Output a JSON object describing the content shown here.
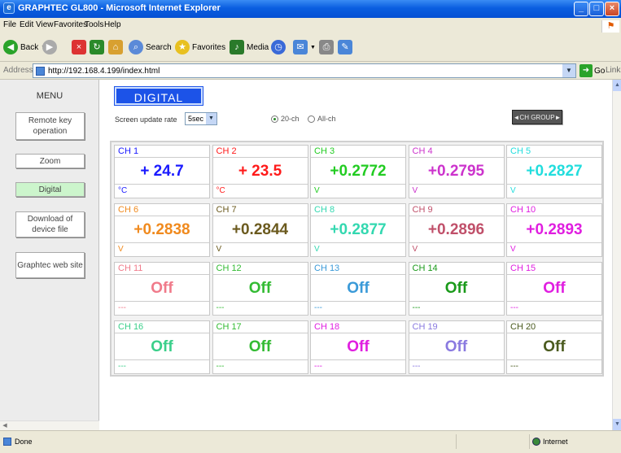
{
  "window": {
    "title": "GRAPHTEC GL800 - Microsoft Internet Explorer"
  },
  "menubar": {
    "items": [
      "File",
      "Edit",
      "View",
      "Favorites",
      "Tools",
      "Help"
    ]
  },
  "toolbar": {
    "back": "Back",
    "search": "Search",
    "favorites": "Favorites",
    "media": "Media"
  },
  "address": {
    "label": "Address",
    "url": "http://192.168.4.199/index.html",
    "go": "Go",
    "links": "Links"
  },
  "sidebar": {
    "title": "MENU",
    "items": [
      "Remote key operation",
      "Zoom",
      "Digital",
      "Download of device file",
      "Graphtec web site"
    ]
  },
  "main": {
    "title": "DIGITAL",
    "update_label": "Screen update rate",
    "update_value": "5sec",
    "radio_20ch": "20-ch",
    "radio_allch": "All-ch",
    "chgroup": "◄CH GROUP►"
  },
  "channels": [
    {
      "name": "CH 1",
      "value": "+ 24.7",
      "unit": "°C",
      "color": "#1a1aff"
    },
    {
      "name": "CH 2",
      "value": "+ 23.5",
      "unit": "°C",
      "color": "#ff1a1a"
    },
    {
      "name": "CH 3",
      "value": "+0.2772",
      "unit": "V",
      "color": "#22cc22"
    },
    {
      "name": "CH 4",
      "value": "+0.2795",
      "unit": "V",
      "color": "#cc33cc"
    },
    {
      "name": "CH 5",
      "value": "+0.2827",
      "unit": "V",
      "color": "#22dddd"
    },
    {
      "name": "CH 6",
      "value": "+0.2838",
      "unit": "V",
      "color": "#f08a1e"
    },
    {
      "name": "CH 7",
      "value": "+0.2844",
      "unit": "V",
      "color": "#6b5a1e"
    },
    {
      "name": "CH 8",
      "value": "+0.2877",
      "unit": "V",
      "color": "#33d8b0"
    },
    {
      "name": "CH 9",
      "value": "+0.2896",
      "unit": "V",
      "color": "#c0506a"
    },
    {
      "name": "CH 10",
      "value": "+0.2893",
      "unit": "V",
      "color": "#e01ee0"
    },
    {
      "name": "CH 11",
      "value": "Off",
      "unit": "---",
      "color": "#f07a8a"
    },
    {
      "name": "CH 12",
      "value": "Off",
      "unit": "---",
      "color": "#33bb33"
    },
    {
      "name": "CH 13",
      "value": "Off",
      "unit": "---",
      "color": "#3a9ad8"
    },
    {
      "name": "CH 14",
      "value": "Off",
      "unit": "---",
      "color": "#1a9a1a"
    },
    {
      "name": "CH 15",
      "value": "Off",
      "unit": "---",
      "color": "#e01ee0"
    },
    {
      "name": "CH 16",
      "value": "Off",
      "unit": "---",
      "color": "#3acf8a"
    },
    {
      "name": "CH 17",
      "value": "Off",
      "unit": "---",
      "color": "#33bb33"
    },
    {
      "name": "CH 18",
      "value": "Off",
      "unit": "---",
      "color": "#e01ee0"
    },
    {
      "name": "CH 19",
      "value": "Off",
      "unit": "---",
      "color": "#8a7ae0"
    },
    {
      "name": "CH 20",
      "value": "Off",
      "unit": "---",
      "color": "#4a5a1e"
    }
  ],
  "status": {
    "left": "Done",
    "zone": "Internet"
  }
}
